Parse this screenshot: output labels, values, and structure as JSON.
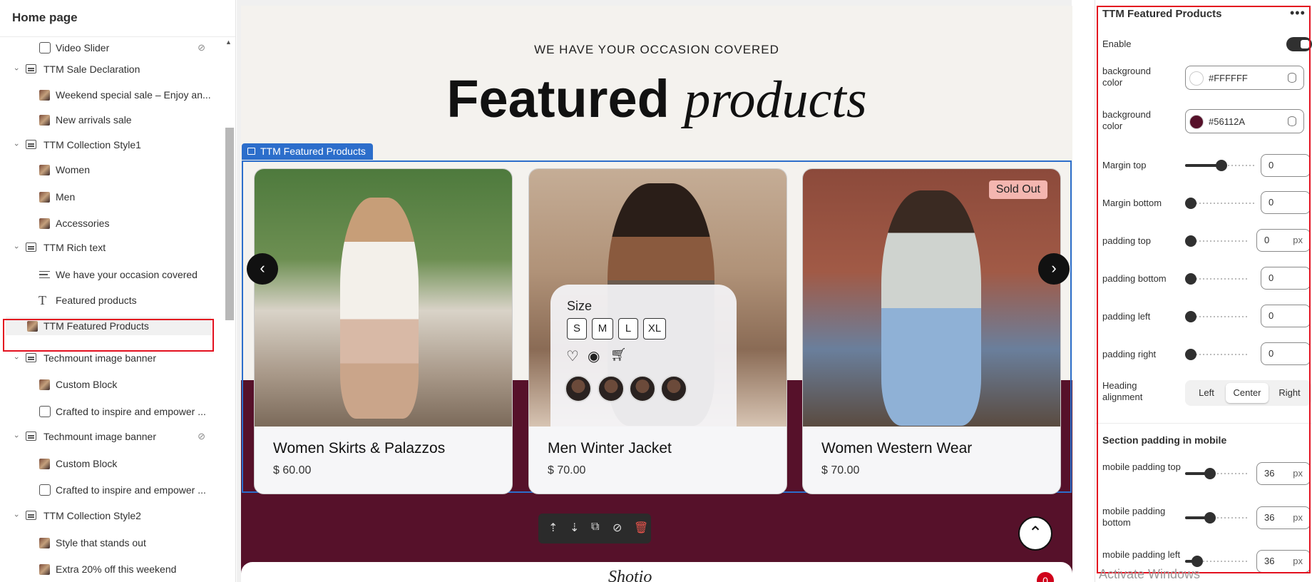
{
  "sidebar": {
    "title": "Home page",
    "items": [
      {
        "label": "Video Slider",
        "level": 2,
        "icon": "frame-icon",
        "hidden": true
      },
      {
        "label": "TTM Sale Declaration",
        "level": 1,
        "icon": "section-icon"
      },
      {
        "label": "Weekend special sale – Enjoy an...",
        "level": 2,
        "icon": "image-thumb"
      },
      {
        "label": "New arrivals sale",
        "level": 2,
        "icon": "image-thumb"
      },
      {
        "label": "TTM Collection Style1",
        "level": 1,
        "icon": "section-icon"
      },
      {
        "label": "Women",
        "level": 2,
        "icon": "image-thumb"
      },
      {
        "label": "Men",
        "level": 2,
        "icon": "image-thumb"
      },
      {
        "label": "Accessories",
        "level": 2,
        "icon": "image-thumb"
      },
      {
        "label": "TTM Rich text",
        "level": 1,
        "icon": "richtext-icon"
      },
      {
        "label": "We have your occasion covered",
        "level": 2,
        "icon": "text-lines-icon"
      },
      {
        "label": "Featured products",
        "level": 2,
        "icon": "text-heading-icon"
      },
      {
        "label": "TTM Featured Products",
        "level": 1,
        "icon": "image-thumb",
        "selected": true
      },
      {
        "label": "Techmount image banner",
        "level": 1,
        "icon": "image-icon"
      },
      {
        "label": "Custom Block",
        "level": 2,
        "icon": "image-thumb"
      },
      {
        "label": "Crafted to inspire and empower ...",
        "level": 2,
        "icon": "image-icon"
      },
      {
        "label": "Techmount image banner",
        "level": 1,
        "icon": "image-icon",
        "hidden": true
      },
      {
        "label": "Custom Block",
        "level": 2,
        "icon": "image-thumb"
      },
      {
        "label": "Crafted to inspire and empower ...",
        "level": 2,
        "icon": "image-icon"
      },
      {
        "label": "TTM Collection Style2",
        "level": 1,
        "icon": "section-icon"
      },
      {
        "label": "Style that stands out",
        "level": 2,
        "icon": "image-thumb"
      },
      {
        "label": "Extra 20% off this weekend",
        "level": 2,
        "icon": "image-thumb"
      }
    ]
  },
  "preview": {
    "kicker": "WE HAVE YOUR OCCASION COVERED",
    "title_plain": "Featured",
    "title_italic": "products",
    "section_tag": "TTM Featured Products",
    "size_title": "Size",
    "sizes": [
      "S",
      "M",
      "L",
      "XL"
    ],
    "badge": "Sold Out",
    "products": [
      {
        "name": "Women Skirts & Palazzos",
        "price": "$ 60.00"
      },
      {
        "name": "Men Winter Jacket",
        "price": "$ 70.00"
      },
      {
        "name": "Women Western Wear",
        "price": "$ 70.00"
      }
    ],
    "footer_logo": "Shotio",
    "cart_count": "0"
  },
  "settings": {
    "title": "TTM Featured Products",
    "enable_label": "Enable",
    "enable_on": true,
    "bg_label_1": "background color",
    "bg_value_1": "#FFFFFF",
    "bg_label_2": "background color",
    "bg_value_2": "#56112A",
    "margin_top_label": "Margin top",
    "margin_top": "0",
    "margin_bottom_label": "Margin bottom",
    "margin_bottom": "0",
    "padding_top_label": "padding top",
    "padding_top": "0",
    "padding_bottom_label": "padding bottom",
    "padding_bottom": "0",
    "padding_left_label": "padding left",
    "padding_left": "0",
    "padding_right_label": "padding right",
    "padding_right": "0",
    "unit": "px",
    "heading_align_label": "Heading alignment",
    "align_options": [
      "Left",
      "Center",
      "Right"
    ],
    "align_selected": "Center",
    "mobile_section_title": "Section padding in mobile",
    "mobile_top_label": "mobile padding top",
    "mobile_top": "36",
    "mobile_bottom_label": "mobile padding bottom",
    "mobile_bottom": "36",
    "mobile_left_label": "mobile padding left",
    "mobile_left": "36"
  },
  "watermark": "Activate Windows",
  "colors": {
    "accent": "#2c6ecb",
    "highlight": "#e3101f",
    "maroon": "#56112a"
  }
}
